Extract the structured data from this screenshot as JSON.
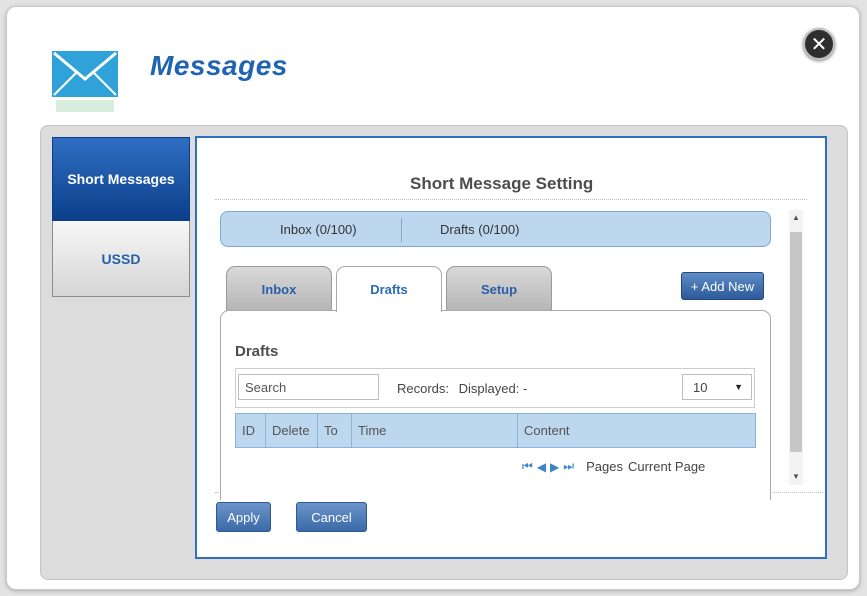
{
  "app": {
    "title": "Messages"
  },
  "sidebar": {
    "items": [
      {
        "label": "Short Messages"
      },
      {
        "label": "USSD"
      }
    ]
  },
  "panel": {
    "title": "Short Message Setting"
  },
  "counts": {
    "inbox": "Inbox (0/100)",
    "drafts": "Drafts (0/100)"
  },
  "tabs": [
    {
      "label": "Inbox"
    },
    {
      "label": "Drafts"
    },
    {
      "label": "Setup"
    }
  ],
  "add_new": "+ Add New",
  "drafts": {
    "heading": "Drafts",
    "search": {
      "placeholder": "Search"
    },
    "records_label": "Records:",
    "displayed_label": "Displayed: -",
    "page_size": "10",
    "columns": [
      "ID",
      "Delete",
      "To",
      "Time",
      "Content"
    ],
    "pages_label": "Pages",
    "current_page_label": "Current Page"
  },
  "actions": {
    "apply": "Apply",
    "cancel": "Cancel"
  },
  "colors": {
    "accent": "#1f63b5",
    "active_sidebar": "#0b3f8a",
    "table_header": "#bcd7ee",
    "panel_border": "#2f6fc0"
  }
}
